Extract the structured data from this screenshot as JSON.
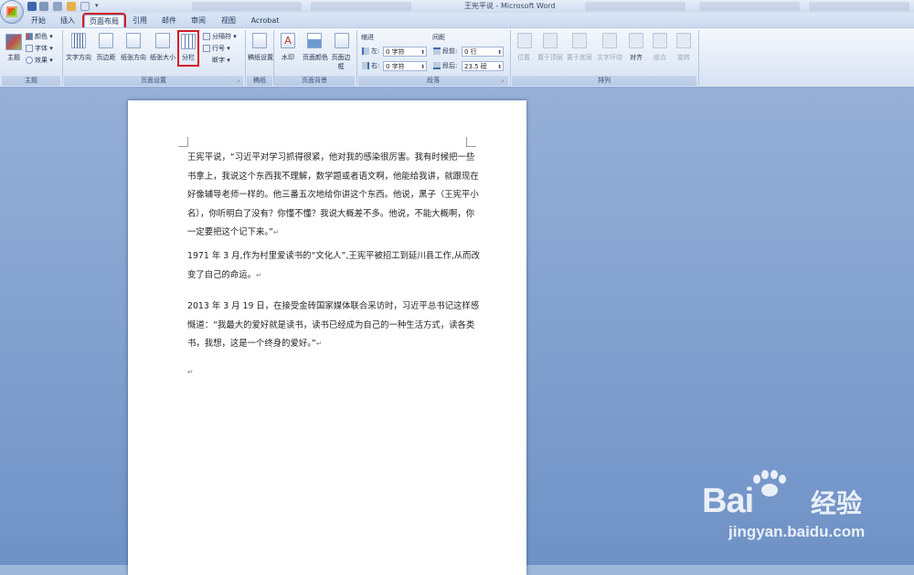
{
  "window": {
    "title": "王宪平说 - Microsoft Word"
  },
  "tabs": [
    "开始",
    "插入",
    "页面布局",
    "引用",
    "邮件",
    "审阅",
    "视图",
    "Acrobat"
  ],
  "ribbon": {
    "theme_group": {
      "label": "主题",
      "theme_button": "主题",
      "colors": "颜色",
      "fonts": "字体",
      "effects": "效果"
    },
    "page_setup": {
      "label": "页面设置",
      "text_direction": "文字方向",
      "margins": "页边距",
      "orientation": "纸张方向",
      "size": "纸张大小",
      "columns": "分栏",
      "breaks": "分隔符",
      "line_numbers": "行号",
      "hyphenation": "断字"
    },
    "draft": {
      "label": "稿纸",
      "button": "稿纸设置"
    },
    "page_background": {
      "label": "页面背景",
      "watermark": "水印",
      "page_color": "页面颜色",
      "page_borders": "页面边框"
    },
    "paragraph": {
      "label": "段落",
      "indent_title": "缩进",
      "spacing_title": "间距",
      "left_label": "左:",
      "left_value": "0 字符",
      "right_label": "右:",
      "right_value": "0 字符",
      "before_label": "段前:",
      "before_value": "0 行",
      "after_label": "段后:",
      "after_value": "23.5 磅"
    },
    "arrange": {
      "label": "排列",
      "position": "位置",
      "bring_front": "置于顶层",
      "send_back": "置于底层",
      "text_wrap": "文字环绕",
      "align": "对齐",
      "group": "组合",
      "rotate": "旋转"
    }
  },
  "document": {
    "paragraphs": [
      "王宪平说，“习近平对学习抓得很紧，他对我的感染很厉害。我有时候把一些书拿上，我说这个东西我不理解，数学题或者语文啊，他能给我讲，就跟现在好像辅导老师一样的。他三番五次地给你讲这个东西。他说，黑子（王宪平小名），你听明白了没有？你懂不懂？我说大概差不多。他说，不能大概啊，你一定要把这个记下来。”",
      "1971 年 3 月,作为村里爱读书的“文化人”,王宪平被招工到延川县工作,从而改变了自己的命运。",
      "2013 年 3 月 19 日，在接受金砖国家媒体联合采访时，习近平总书记这样感慨道：“我最大的爱好就是读书，读书已经成为自己的一种生活方式，读各类书，我想，这是一个终身的爱好。”"
    ],
    "paragraph_mark": "↵"
  },
  "watermark": {
    "brand": "Bai",
    "brand_suffix": "经验",
    "url": "jingyan.baidu.com"
  },
  "colors": {
    "highlight_red": "#d21f26",
    "ribbon_bg": "#dbe6f5",
    "workspace": "#7c9acb"
  }
}
